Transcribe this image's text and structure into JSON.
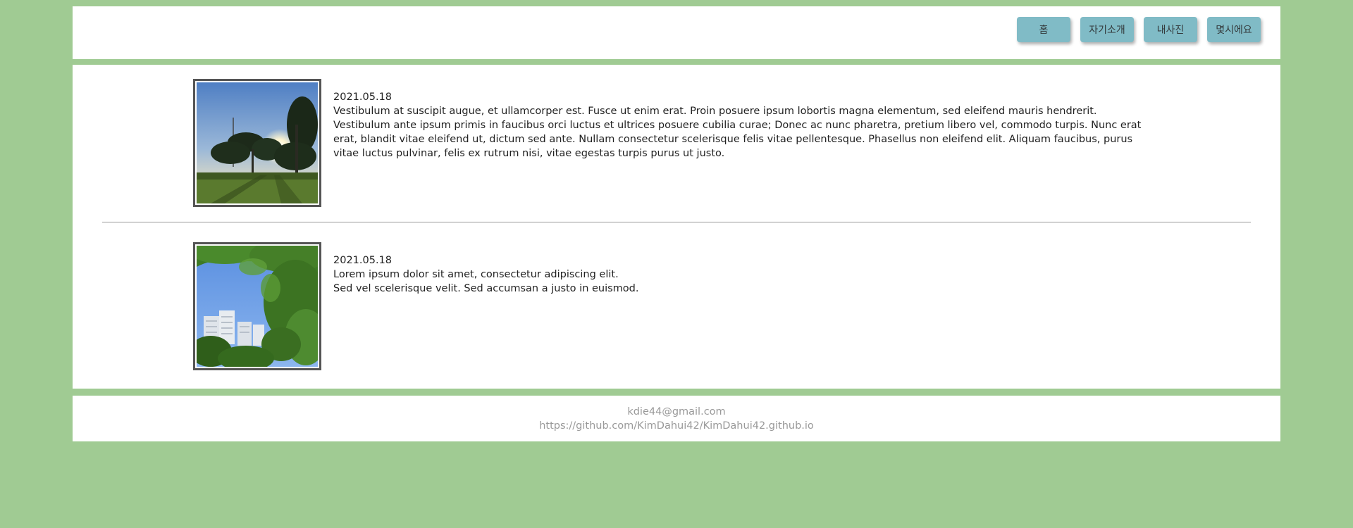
{
  "nav": {
    "items": [
      {
        "label": "홈"
      },
      {
        "label": "자기소개"
      },
      {
        "label": "내사진"
      },
      {
        "label": "몇시에요"
      }
    ]
  },
  "posts": [
    {
      "date": "2021.05.18",
      "lines": [
        "Vestibulum at suscipit augue, et ullamcorper est. Fusce ut enim erat. Proin posuere ipsum lobortis magna elementum, sed eleifend mauris hendrerit. Vestibulum ante ipsum primis in faucibus orci luctus et ultrices posuere cubilia curae; Donec ac nunc pharetra, pretium libero vel, commodo turpis. Nunc erat erat, blandit vitae eleifend ut, dictum sed ante. Nullam consectetur scelerisque felis vitae pellentesque. Phasellus non eleifend elit. Aliquam faucibus, purus vitae luctus pulvinar, felis ex rutrum nisi, vitae egestas turpis purus ut justo."
      ]
    },
    {
      "date": "2021.05.18",
      "lines": [
        "Lorem ipsum dolor sit amet, consectetur adipiscing elit.",
        "Sed vel scelerisque velit. Sed accumsan a justo in euismod."
      ]
    }
  ],
  "footer": {
    "email": "kdie44@gmail.com",
    "url": "https://github.com/KimDahui42/KimDahui42.github.io"
  },
  "colors": {
    "background": "#a0cb93",
    "nav_button": "#80bbc6",
    "panel": "#ffffff"
  }
}
